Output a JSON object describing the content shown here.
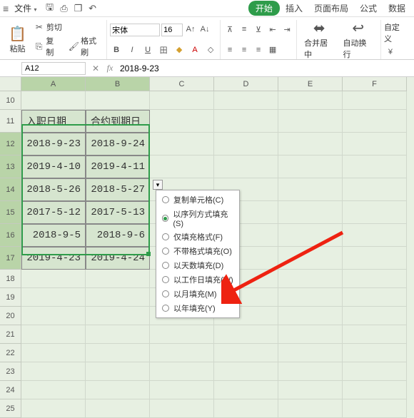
{
  "menubar": {
    "file": "文件",
    "tabs": [
      "开始",
      "插入",
      "页面布局",
      "公式",
      "数据"
    ],
    "active_tab": 0
  },
  "toolbar": {
    "paste": "粘贴",
    "cut": "剪切",
    "copy": "复制",
    "format_painter": "格式刷",
    "font_name": "宋体",
    "font_size": "16",
    "merge": "合并居中",
    "wrap": "自动换行",
    "custom": "自定义"
  },
  "formula_bar": {
    "name_box": "A12",
    "formula": "2018-9-23"
  },
  "columns": [
    "A",
    "B",
    "C",
    "D",
    "E",
    "F"
  ],
  "rows": [
    "10",
    "11",
    "12",
    "13",
    "14",
    "15",
    "16",
    "17",
    "18",
    "19",
    "20",
    "21",
    "22",
    "23",
    "24",
    "25"
  ],
  "table": {
    "header": [
      "入职日期",
      "合约到期日"
    ],
    "data": [
      [
        "2018-9-23",
        "2018-9-24"
      ],
      [
        "2019-4-10",
        "2019-4-11"
      ],
      [
        "2018-5-26",
        "2018-5-27"
      ],
      [
        "2017-5-12",
        "2017-5-13"
      ],
      [
        "2018-9-5",
        "2018-9-6"
      ],
      [
        "2019-4-23",
        "2019-4-24"
      ]
    ]
  },
  "fill_menu": {
    "items": [
      "复制单元格(C)",
      "以序列方式填充(S)",
      "仅填充格式(F)",
      "不带格式填充(O)",
      "以天数填充(D)",
      "以工作日填充(W)",
      "以月填充(M)",
      "以年填充(Y)"
    ],
    "selected": 1
  }
}
